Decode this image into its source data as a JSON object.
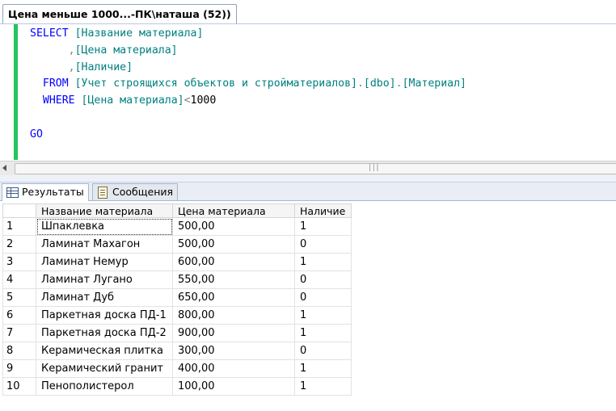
{
  "document_tab": {
    "title": "Цена меньше 1000...-ПК\\наташа (52))"
  },
  "query": {
    "line1": {
      "kw": "SELECT",
      "col": "[Название материала]"
    },
    "line2": {
      "sep": ",",
      "col": "[Цена материала]"
    },
    "line3": {
      "sep": ",",
      "col": "[Наличие]"
    },
    "line4": {
      "kw": "FROM",
      "obj": "[Учет строящихся объектов и стройматериалов]",
      "dot1": ".",
      "schema": "[dbo]",
      "dot2": ".",
      "table": "[Материал]"
    },
    "line5": {
      "kw": "WHERE",
      "col": "[Цена материала]",
      "op": "<",
      "num": "1000"
    },
    "line6": {
      "kw": "GO"
    }
  },
  "result_tabs": {
    "results_label": "Результаты",
    "messages_label": "Сообщения"
  },
  "grid": {
    "columns": [
      "Название материала",
      "Цена материала",
      "Наличие"
    ],
    "rows": [
      {
        "n": "1",
        "name": "Шпаклевка",
        "price": "500,00",
        "avail": "1"
      },
      {
        "n": "2",
        "name": "Ламинат Махагон",
        "price": "500,00",
        "avail": "0"
      },
      {
        "n": "3",
        "name": "Ламинат Немур",
        "price": "600,00",
        "avail": "1"
      },
      {
        "n": "4",
        "name": "Ламинат Лугано",
        "price": "550,00",
        "avail": "0"
      },
      {
        "n": "5",
        "name": "Ламинат Дуб",
        "price": "650,00",
        "avail": "0"
      },
      {
        "n": "6",
        "name": "Паркетная доска ПД-1",
        "price": "800,00",
        "avail": "1"
      },
      {
        "n": "7",
        "name": "Паркетная доска ПД-2",
        "price": "900,00",
        "avail": "1"
      },
      {
        "n": "8",
        "name": "Керамическая плитка",
        "price": "300,00",
        "avail": "0"
      },
      {
        "n": "9",
        "name": "Керамический гранит",
        "price": "400,00",
        "avail": "1"
      },
      {
        "n": "10",
        "name": "Пенополистерол",
        "price": "100,00",
        "avail": "1"
      }
    ]
  },
  "colors": {
    "keyword": "#0000ff",
    "identifier": "#008080",
    "operator": "#808080",
    "change_bar": "#22c55e"
  }
}
